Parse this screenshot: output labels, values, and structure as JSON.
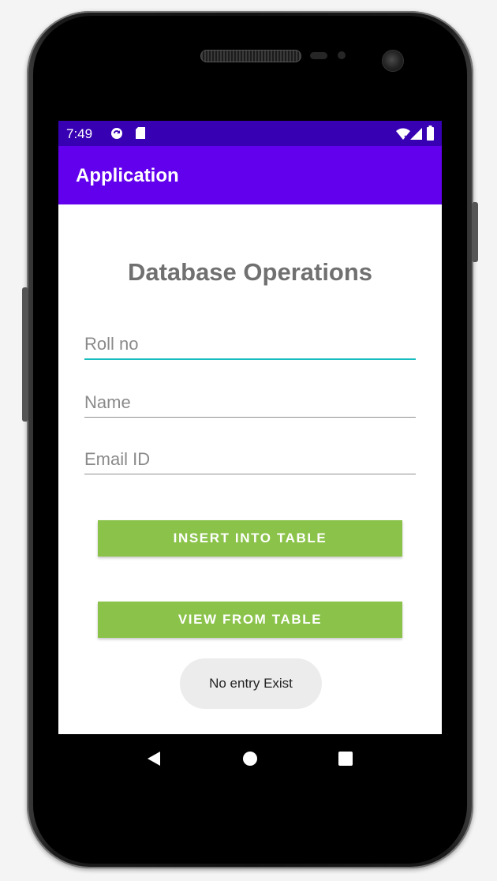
{
  "status_bar": {
    "time": "7:49",
    "icons": [
      "sync-icon",
      "sd-card-icon",
      "wifi-icon",
      "signal-icon",
      "battery-icon"
    ],
    "color": "#3700b3"
  },
  "app_bar": {
    "title": "Application",
    "color": "#6200ee"
  },
  "form": {
    "heading": "Database Operations",
    "roll_placeholder": "Roll no",
    "name_placeholder": "Name",
    "email_placeholder": "Email ID"
  },
  "actions": {
    "insert_label": "INSERT INTO TABLE",
    "view_label": "VIEW FROM TABLE",
    "color": "#8bc34a"
  },
  "toast": {
    "message": "No entry Exist"
  },
  "navigation": {
    "icons": [
      "back-icon",
      "home-icon",
      "recents-icon"
    ]
  },
  "colors": {
    "focused_field": "#17bcc0",
    "heading": "#707070"
  }
}
